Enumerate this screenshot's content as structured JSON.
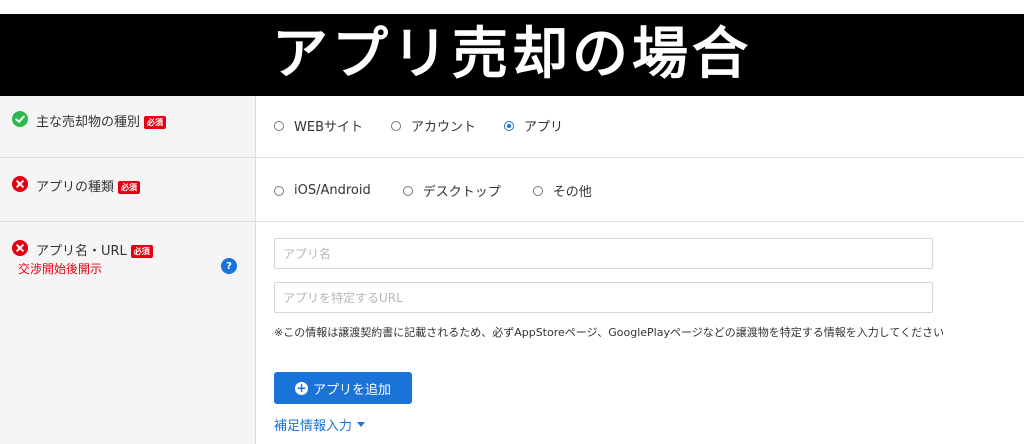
{
  "banner": {
    "title": "アプリ売却の場合"
  },
  "colors": {
    "accent": "#1a73d9",
    "required": "#e60012",
    "ok": "#2eb84b",
    "error": "#e60012"
  },
  "rows": [
    {
      "label": "主な売却物の種別",
      "required_badge": "必須",
      "status": "check-icon",
      "options": [
        {
          "label": "WEBサイト",
          "checked": false
        },
        {
          "label": "アカウント",
          "checked": false
        },
        {
          "label": "アプリ",
          "checked": true
        }
      ]
    },
    {
      "label": "アプリの種類",
      "required_badge": "必須",
      "status": "error-icon",
      "options": [
        {
          "label": "iOS/Android",
          "checked": false
        },
        {
          "label": "デスクトップ",
          "checked": false
        },
        {
          "label": "その他",
          "checked": false
        }
      ]
    },
    {
      "label": "アプリ名・URL",
      "required_badge": "必須",
      "status": "error-icon",
      "reveal_note": "交渉開始後開示",
      "help": "?",
      "inputs": [
        {
          "placeholder": "アプリ名",
          "value": ""
        },
        {
          "placeholder": "アプリを特定するURL",
          "value": ""
        }
      ],
      "note": "※この情報は譲渡契約書に記載されるため、必ずAppStoreページ、GooglePlayページなどの譲渡物を特定する情報を入力してください",
      "add_button": "アプリを追加",
      "add_icon": "+",
      "more_link": "補足情報入力"
    }
  ]
}
